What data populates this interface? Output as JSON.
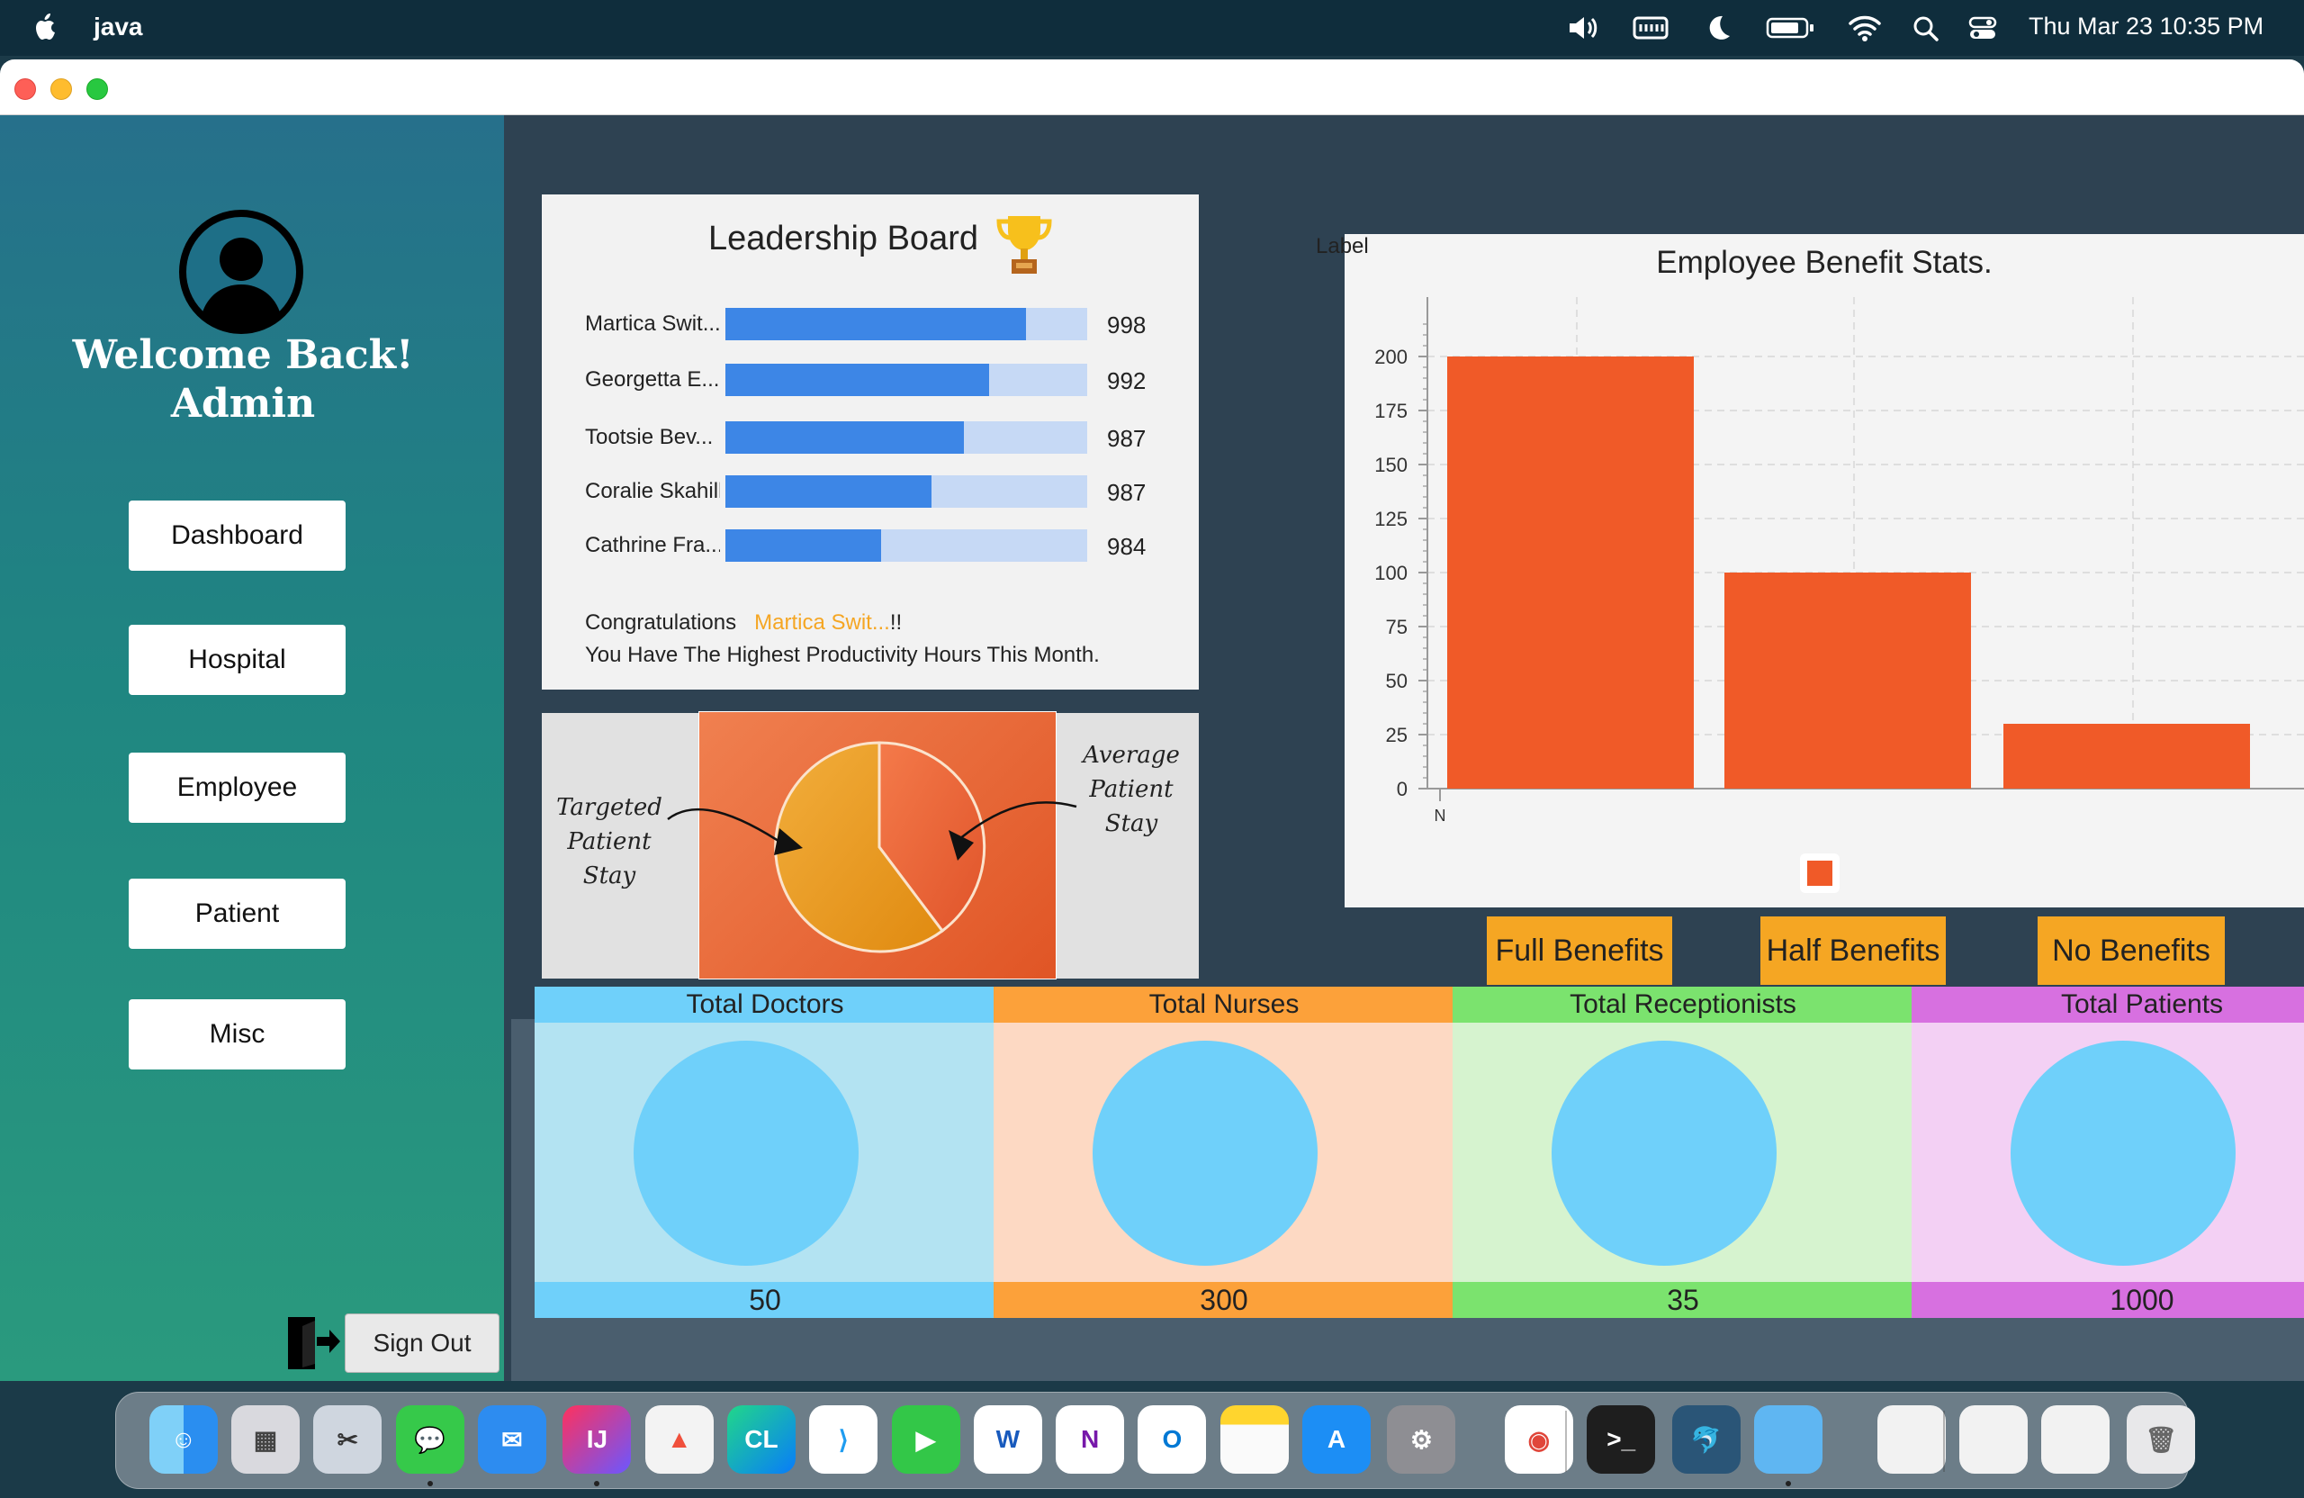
{
  "menubar": {
    "app_name": "java",
    "clock": "Thu Mar 23  10:35 PM"
  },
  "sidebar": {
    "welcome_line1": "Welcome Back!",
    "welcome_line2": "Admin",
    "nav": [
      "Dashboard",
      "Hospital",
      "Employee",
      "Patient",
      "Misc"
    ],
    "signout": "Sign Out"
  },
  "leaderboard": {
    "title": "Leadership Board",
    "entries": [
      {
        "name": "Martica Swit...",
        "score": 998,
        "fill": 0.83
      },
      {
        "name": "Georgetta E...",
        "score": 992,
        "fill": 0.73
      },
      {
        "name": "Tootsie Bev...",
        "score": 987,
        "fill": 0.66
      },
      {
        "name": "Coralie Skahill",
        "score": 987,
        "fill": 0.57
      },
      {
        "name": "Cathrine Fra...",
        "score": 984,
        "fill": 0.43
      }
    ],
    "congrats_prefix": "Congratulations",
    "congrats_name": "Martica Swit...",
    "congrats_suffix": "!!",
    "congrats_line2": "You Have The Highest Productivity Hours This Month."
  },
  "pie_panel": {
    "left_label": [
      "Targeted",
      "Patient",
      "Stay"
    ],
    "right_label": [
      "Average",
      "Patient",
      "Stay"
    ]
  },
  "chart_data": {
    "type": "bar",
    "title": "Employee Benefit Stats.",
    "label_text": "Label",
    "x_tick": "N",
    "categories": [
      "Full Benefits",
      "Half Benefits",
      "No Benefits"
    ],
    "values": [
      200,
      100,
      30
    ],
    "ylim": [
      0,
      220
    ],
    "yticks": [
      0,
      25,
      50,
      75,
      100,
      125,
      150,
      175,
      200
    ],
    "grid": true,
    "bar_color": "#f05a28"
  },
  "benefit_buttons": [
    "Full Benefits",
    "Half Benefits",
    "No Benefits"
  ],
  "totals": [
    {
      "label": "Total Doctors",
      "value": "50",
      "header_color": "#6fd0fa",
      "body_color": "#b3e3f2"
    },
    {
      "label": "Total Nurses",
      "value": "300",
      "header_color": "#fca13a",
      "body_color": "#fdd9c3"
    },
    {
      "label": "Total Receptionists",
      "value": "35",
      "header_color": "#7be36e",
      "body_color": "#d6f3cf"
    },
    {
      "label": "Total Patients",
      "value": "1000",
      "header_color": "#d770e0",
      "body_color": "#f3d0f4"
    }
  ],
  "dock": [
    "finder-icon",
    "launchpad-icon",
    "screenshot-icon",
    "messages-icon",
    "mail-icon",
    "intellij-icon",
    "pastebot-icon",
    "clion-icon",
    "vscode-icon",
    "facetime-icon",
    "word-icon",
    "onenote-icon",
    "outlook-icon",
    "notes-icon",
    "app-store-icon",
    "system-settings-icon",
    "chrome-icon",
    "terminal-icon",
    "mysql-workbench-icon",
    "folder-icon",
    "window-thumbnail-1",
    "window-thumbnail-2",
    "window-thumbnail-3",
    "trash-icon"
  ]
}
